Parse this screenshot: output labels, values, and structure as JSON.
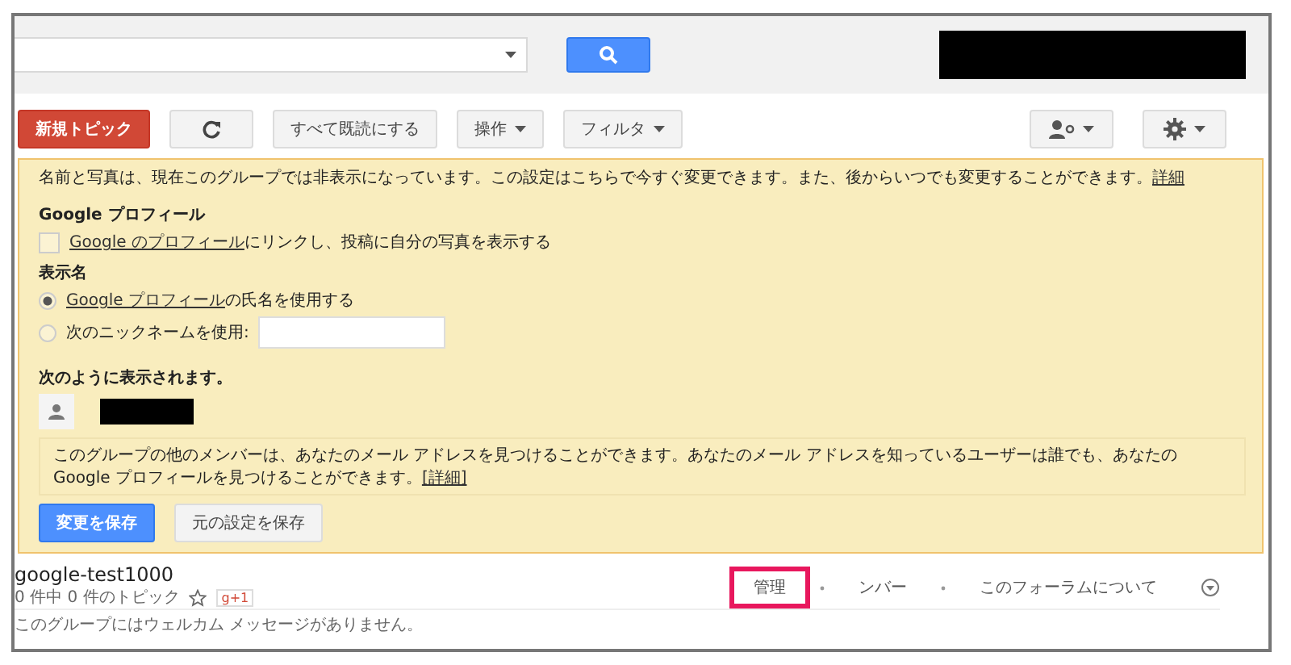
{
  "toolbar": {
    "new_topic": "新規トピック",
    "mark_all_read": "すべて既読にする",
    "menus": [
      {
        "label": "操作"
      },
      {
        "label": "フィルタ"
      }
    ]
  },
  "notice": {
    "text": "名前と写真は、現在このグループでは非表示になっています。この設定はこちらで今すぐ変更できます。また、後からいつでも変更することができます。",
    "link": "詳細",
    "profile": {
      "heading": "Google プロフィール",
      "checked": false,
      "link": "Google のプロフィール",
      "text": "にリンクし、投稿に自分の写真を表示する"
    },
    "display_name": {
      "heading": "表示名",
      "options": [
        {
          "kind": "profile",
          "link": "Google プロフィール",
          "text": "の氏名を使用する",
          "selected": true
        },
        {
          "kind": "nickname",
          "text": "次のニックネームを使用:",
          "selected": false
        }
      ]
    },
    "preview_heading": "次のように表示されます。",
    "info": {
      "text": "このグループの他のメンバーは、あなたのメール アドレスを見つけることができます。あなたのメール アドレスを知っているユーザーは誰でも、あなたの Google プロフィールを見つけることができます。",
      "link": "[詳細]"
    },
    "buttons": [
      {
        "label": "変更を保存",
        "kind": "primary"
      },
      {
        "label": "元の設定を保存",
        "kind": "secondary"
      }
    ]
  },
  "group": {
    "name": "google-test1000",
    "count": "0 件中 0 件のトピック",
    "plus": "g+1",
    "nav": [
      {
        "label": "管理",
        "highlighted": true
      },
      {
        "label": "ンバー",
        "highlighted": false
      },
      {
        "label": "このフォーラムについて",
        "highlighted": false
      }
    ],
    "welcome": "このグループにはウェルカム メッセージがありません。"
  }
}
